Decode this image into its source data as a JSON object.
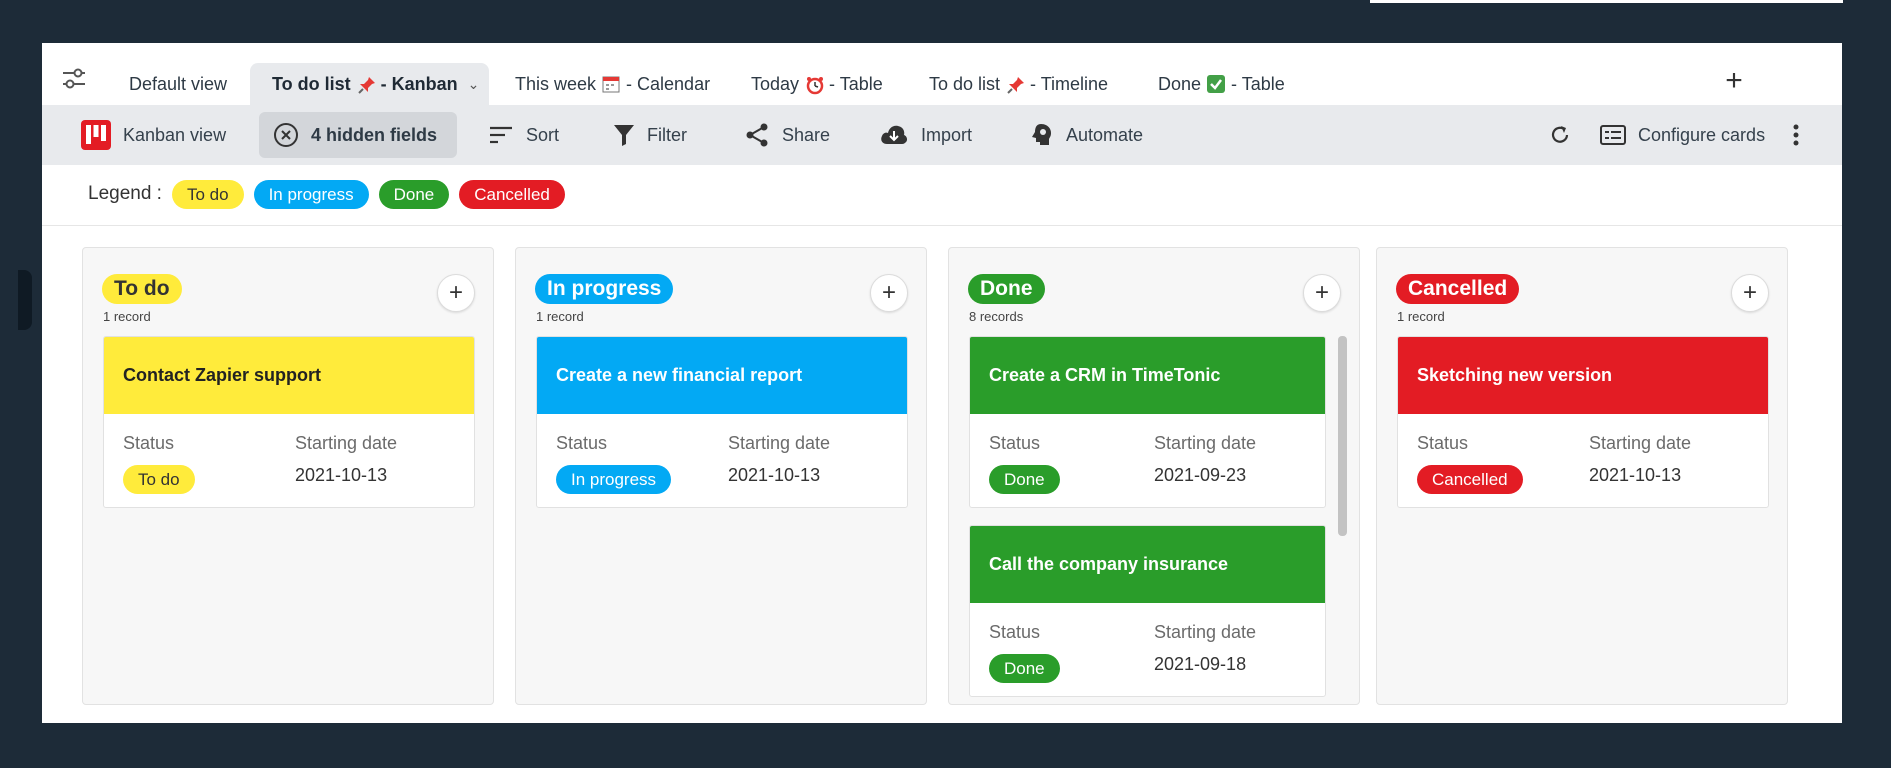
{
  "tabs": [
    {
      "label_pre": "Default view",
      "emoji": "",
      "label_post": ""
    },
    {
      "label_pre": "To do list",
      "emoji": "pushpin",
      "label_post": " - Kanban"
    },
    {
      "label_pre": "This week",
      "emoji": "calendar",
      "label_post": " - Calendar"
    },
    {
      "label_pre": "Today",
      "emoji": "alarm-clock",
      "label_post": " - Table"
    },
    {
      "label_pre": "To do list",
      "emoji": "pushpin",
      "label_post": " - Timeline"
    },
    {
      "label_pre": "Done",
      "emoji": "check-box",
      "label_post": " - Table"
    }
  ],
  "toolbar": {
    "kanban_view": "Kanban view",
    "hidden_fields": "4 hidden fields",
    "sort": "Sort",
    "filter": "Filter",
    "share": "Share",
    "import": "Import",
    "automate": "Automate",
    "configure_cards": "Configure cards"
  },
  "legend": {
    "label": "Legend :",
    "items": [
      "To do",
      "In progress",
      "Done",
      "Cancelled"
    ]
  },
  "fields": {
    "status": "Status",
    "starting_date": "Starting date"
  },
  "columns": [
    {
      "title": "To do",
      "count": "1 record",
      "cards": [
        {
          "title": "Contact Zapier support",
          "status": "To do",
          "date": "2021-10-13"
        }
      ]
    },
    {
      "title": "In progress",
      "count": "1 record",
      "cards": [
        {
          "title": "Create a new financial report",
          "status": "In progress",
          "date": "2021-10-13"
        }
      ]
    },
    {
      "title": "Done",
      "count": "8 records",
      "cards": [
        {
          "title": "Create a CRM in TimeTonic",
          "status": "Done",
          "date": "2021-09-23"
        },
        {
          "title": "Call the company insurance",
          "status": "Done",
          "date": "2021-09-18"
        }
      ]
    },
    {
      "title": "Cancelled",
      "count": "1 record",
      "cards": [
        {
          "title": "Sketching new version",
          "status": "Cancelled",
          "date": "2021-10-13"
        }
      ]
    }
  ],
  "colors": {
    "todo": "#ffeb3b",
    "in_progress": "#03a9f4",
    "done": "#2a9d2a",
    "cancelled": "#e31c24"
  }
}
